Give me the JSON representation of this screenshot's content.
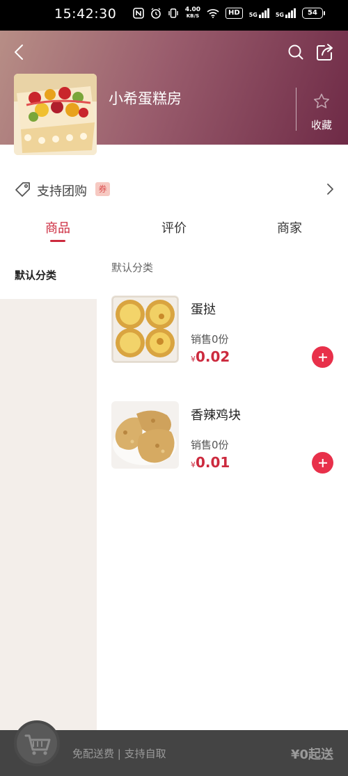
{
  "status_bar": {
    "time": "15:42:30",
    "net_speed_value": "4.00",
    "net_speed_unit": "KB/S",
    "hd_label": "HD",
    "sim1_label": "5G",
    "sim2_label": "5G",
    "battery": "54",
    "icons": [
      "nfc-icon",
      "alarm-icon",
      "vibrate-icon",
      "wifi-icon",
      "signal-icon",
      "battery-icon"
    ]
  },
  "header": {
    "shop_name": "小希蛋糕房",
    "favorite_label": "收藏",
    "icons": [
      "back-icon",
      "search-icon",
      "share-icon",
      "star-icon"
    ]
  },
  "groupbuy": {
    "label": "支持团购",
    "badge": "券"
  },
  "tabs": [
    {
      "label": "商品",
      "active": true
    },
    {
      "label": "评价",
      "active": false
    },
    {
      "label": "商家",
      "active": false
    }
  ],
  "sidebar": {
    "items": [
      {
        "label": "默认分类",
        "selected": true
      }
    ]
  },
  "category": {
    "title": "默认分类"
  },
  "products": [
    {
      "name": "蛋挞",
      "sales": "销售0份",
      "currency": "¥",
      "price": "0.02"
    },
    {
      "name": "香辣鸡块",
      "sales": "销售0份",
      "currency": "¥",
      "price": "0.01"
    }
  ],
  "cart": {
    "info": "免配送费 | 支持自取",
    "min_order": "¥0起送"
  },
  "colors": {
    "accent": "#cc2a3e",
    "add_button": "#e8304a",
    "header_gradient_end": "#6e2a46",
    "cart_bar": "#444444"
  }
}
